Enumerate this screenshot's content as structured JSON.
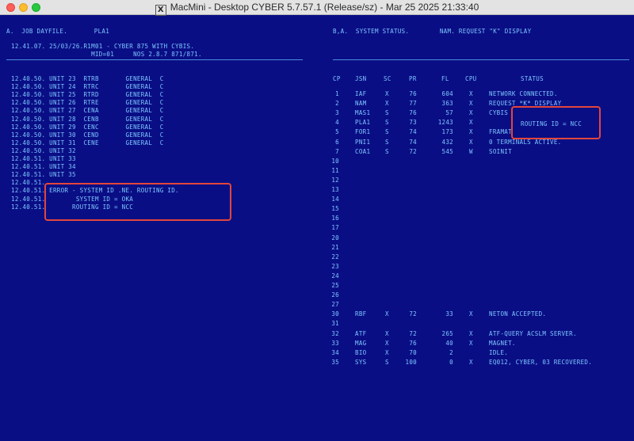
{
  "window": {
    "title": "MacMini - Desktop CYBER 5.7.57.1 (Release/sz)  - Mar 25 2025 21:33:40",
    "close_label": "close",
    "minimize_label": "minimize",
    "zoom_label": "zoom"
  },
  "left": {
    "header": "A.  JOB DAYFILE.       PLA1",
    "banner1": "12.41.07. 25/03/26.R1M01 - CYBER 875 WITH CYBIS.",
    "banner2": "                     MID=01     NOS 2.8.7 871/871.",
    "log": [
      "12.40.50. UNIT 23  RTRB       GENERAL  C",
      "12.40.50. UNIT 24  RTRC       GENERAL  C",
      "12.40.50. UNIT 25  RTRD       GENERAL  C",
      "12.40.50. UNIT 26  RTRE       GENERAL  C",
      "12.40.50. UNIT 27  CENA       GENERAL  C",
      "12.40.50. UNIT 28  CENB       GENERAL  C",
      "12.40.50. UNIT 29  CENC       GENERAL  C",
      "12.40.50. UNIT 30  CEND       GENERAL  C",
      "12.40.50. UNIT 31  CENE       GENERAL  C",
      "12.40.50. UNIT 32",
      "12.40.51. UNIT 33",
      "12.40.51. UNIT 34",
      "12.40.51. UNIT 35",
      "12.40.51.",
      "12.40.51. ERROR - SYSTEM ID .NE. ROUTING ID.",
      "12.40.51.        SYSTEM ID = OKA",
      "12.40.51.       ROUTING ID = NCC"
    ]
  },
  "right": {
    "header": "B,A.  SYSTEM STATUS.        NAM. REQUEST \"K\" DISPLAY",
    "columns": [
      "CP",
      "JSN",
      "SC",
      "PR",
      "FL",
      "CPU",
      "STATUS"
    ],
    "rows": [
      {
        "cp": "1",
        "jsn": "IAF",
        "sc": "X",
        "pr": "76",
        "fl": "604",
        "cpu": "X",
        "status": "NETWORK CONNECTED."
      },
      {
        "cp": "2",
        "jsn": "NAM",
        "sc": "X",
        "pr": "77",
        "fl": "363",
        "cpu": "X",
        "status": "REQUEST *K* DISPLAY"
      },
      {
        "cp": "3",
        "jsn": "MAS1",
        "sc": "S",
        "pr": "76",
        "fl": "57",
        "cpu": "X",
        "status": "CYBIS"
      },
      {
        "cp": "4",
        "jsn": "PLA1",
        "sc": "S",
        "pr": "73",
        "fl": "1243",
        "cpu": "X",
        "status": ""
      },
      {
        "cp": "5",
        "jsn": "FOR1",
        "sc": "S",
        "pr": "74",
        "fl": "173",
        "cpu": "X",
        "status": "FRAMAT"
      },
      {
        "cp": "6",
        "jsn": "PNI1",
        "sc": "S",
        "pr": "74",
        "fl": "432",
        "cpu": "X",
        "status": "0 TERMINALS ACTIVE."
      },
      {
        "cp": "7",
        "jsn": "COA1",
        "sc": "S",
        "pr": "72",
        "fl": "545",
        "cpu": "W",
        "status": "SOINIT"
      },
      {
        "cp": "10",
        "jsn": "",
        "sc": "",
        "pr": "",
        "fl": "",
        "cpu": "",
        "status": ""
      },
      {
        "cp": "11",
        "jsn": "",
        "sc": "",
        "pr": "",
        "fl": "",
        "cpu": "",
        "status": ""
      },
      {
        "cp": "12",
        "jsn": "",
        "sc": "",
        "pr": "",
        "fl": "",
        "cpu": "",
        "status": ""
      },
      {
        "cp": "13",
        "jsn": "",
        "sc": "",
        "pr": "",
        "fl": "",
        "cpu": "",
        "status": ""
      },
      {
        "cp": "14",
        "jsn": "",
        "sc": "",
        "pr": "",
        "fl": "",
        "cpu": "",
        "status": ""
      },
      {
        "cp": "15",
        "jsn": "",
        "sc": "",
        "pr": "",
        "fl": "",
        "cpu": "",
        "status": ""
      },
      {
        "cp": "16",
        "jsn": "",
        "sc": "",
        "pr": "",
        "fl": "",
        "cpu": "",
        "status": ""
      },
      {
        "cp": "17",
        "jsn": "",
        "sc": "",
        "pr": "",
        "fl": "",
        "cpu": "",
        "status": ""
      },
      {
        "cp": "20",
        "jsn": "",
        "sc": "",
        "pr": "",
        "fl": "",
        "cpu": "",
        "status": ""
      },
      {
        "cp": "21",
        "jsn": "",
        "sc": "",
        "pr": "",
        "fl": "",
        "cpu": "",
        "status": ""
      },
      {
        "cp": "22",
        "jsn": "",
        "sc": "",
        "pr": "",
        "fl": "",
        "cpu": "",
        "status": ""
      },
      {
        "cp": "23",
        "jsn": "",
        "sc": "",
        "pr": "",
        "fl": "",
        "cpu": "",
        "status": ""
      },
      {
        "cp": "24",
        "jsn": "",
        "sc": "",
        "pr": "",
        "fl": "",
        "cpu": "",
        "status": ""
      },
      {
        "cp": "25",
        "jsn": "",
        "sc": "",
        "pr": "",
        "fl": "",
        "cpu": "",
        "status": ""
      },
      {
        "cp": "26",
        "jsn": "",
        "sc": "",
        "pr": "",
        "fl": "",
        "cpu": "",
        "status": ""
      },
      {
        "cp": "27",
        "jsn": "",
        "sc": "",
        "pr": "",
        "fl": "",
        "cpu": "",
        "status": ""
      },
      {
        "cp": "30",
        "jsn": "RBF",
        "sc": "X",
        "pr": "72",
        "fl": "33",
        "cpu": "X",
        "status": "NETON ACCEPTED."
      },
      {
        "cp": "31",
        "jsn": "",
        "sc": "",
        "pr": "",
        "fl": "",
        "cpu": "",
        "status": ""
      },
      {
        "cp": "32",
        "jsn": "ATF",
        "sc": "X",
        "pr": "72",
        "fl": "265",
        "cpu": "X",
        "status": "ATF-QUERY ACSLM SERVER."
      },
      {
        "cp": "33",
        "jsn": "MAG",
        "sc": "X",
        "pr": "76",
        "fl": "40",
        "cpu": "X",
        "status": "MAGNET."
      },
      {
        "cp": "34",
        "jsn": "BIO",
        "sc": "X",
        "pr": "70",
        "fl": "2",
        "cpu": "",
        "status": "IDLE."
      },
      {
        "cp": "35",
        "jsn": "SYS",
        "sc": "S",
        "pr": "100",
        "fl": "0",
        "cpu": "X",
        "status": "EQ012, CYBER, 03 RECOVERED."
      }
    ],
    "routing_note": "ROUTING ID = NCC"
  },
  "colors": {
    "background": "#0a0e85",
    "text": "#7ec7ff",
    "highlight": "#e2463b"
  }
}
